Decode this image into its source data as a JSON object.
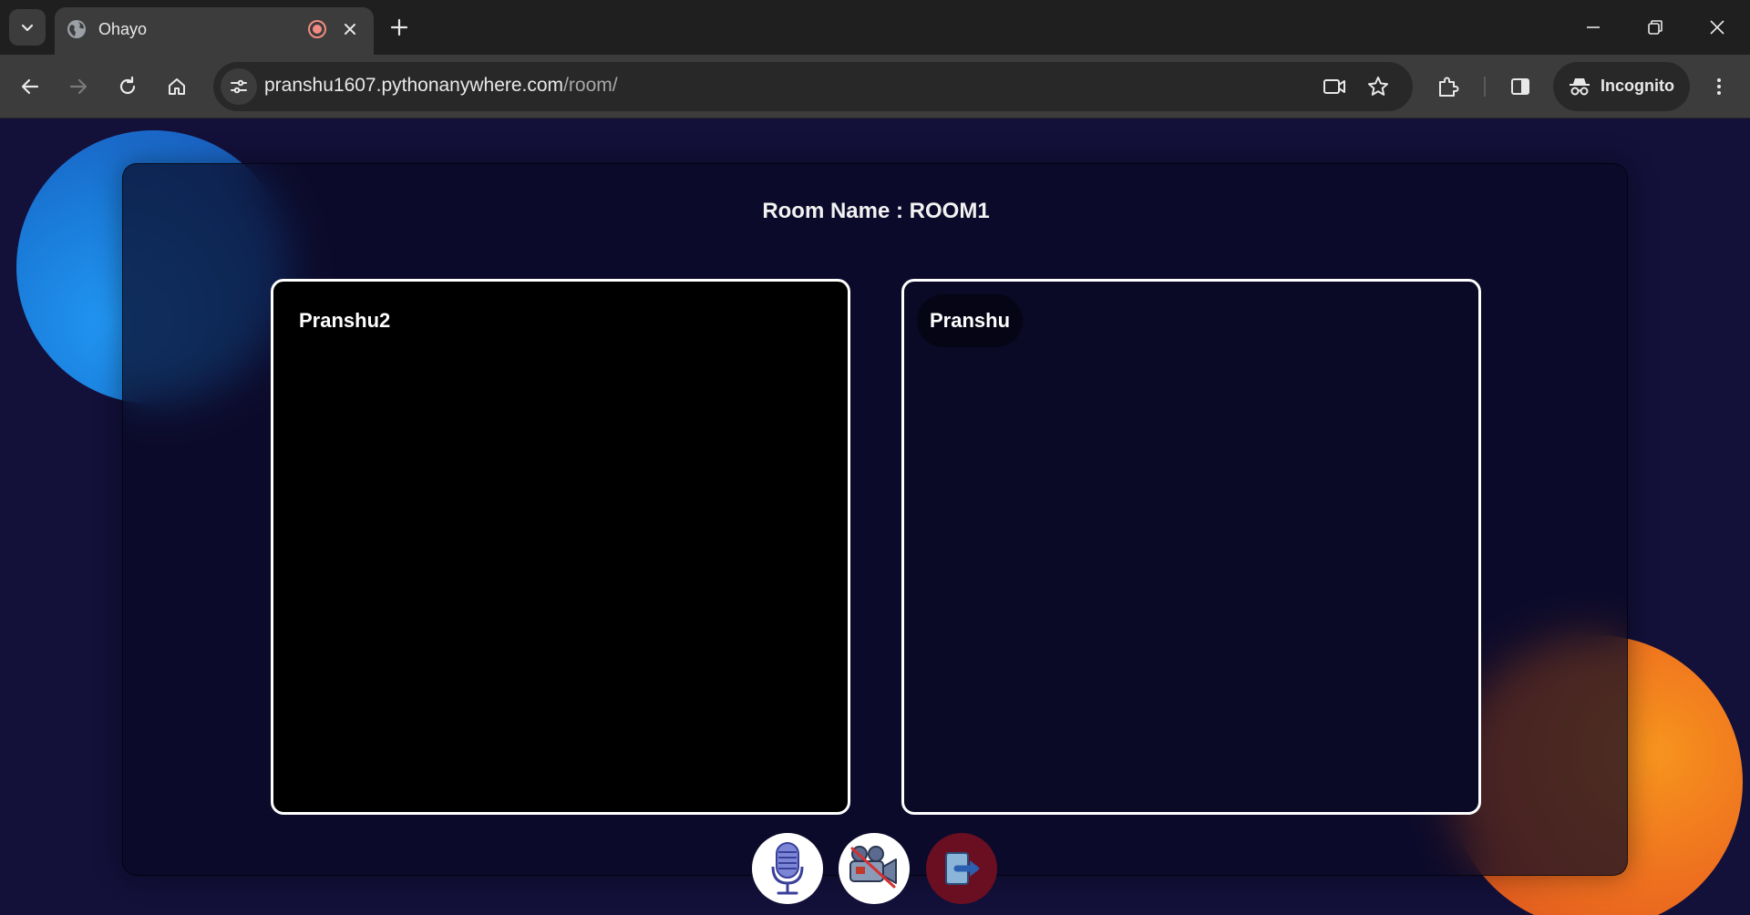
{
  "browser": {
    "tab": {
      "title": "Ohayo"
    },
    "omnibox": {
      "domain": "pranshu1607.pythonanywhere.com",
      "path": "/room/"
    },
    "incognito_label": "Incognito",
    "icons": [
      "tab-search-icon",
      "globe-icon",
      "recording-icon",
      "close-icon",
      "plus-icon",
      "minimize-icon",
      "restore-icon",
      "window-close-icon",
      "back-icon",
      "forward-icon",
      "reload-icon",
      "home-icon",
      "site-settings-icon",
      "camera-icon",
      "star-icon",
      "extensions-icon",
      "side-panel-icon",
      "incognito-icon",
      "more-icon"
    ]
  },
  "room": {
    "label": "Room Name : ",
    "name": "ROOM1"
  },
  "participants": {
    "remote": {
      "name": "Pranshu2"
    },
    "local": {
      "name": "Pranshu"
    }
  },
  "controls": {
    "mic": "microphone-icon",
    "camera": "video-camera-icon",
    "leave": "leave-icon"
  },
  "colors": {
    "page_bg": "#13103a",
    "accent_blue": "#2196f3",
    "accent_orange": "#f7941e",
    "leave_button": "#6a0f22"
  }
}
